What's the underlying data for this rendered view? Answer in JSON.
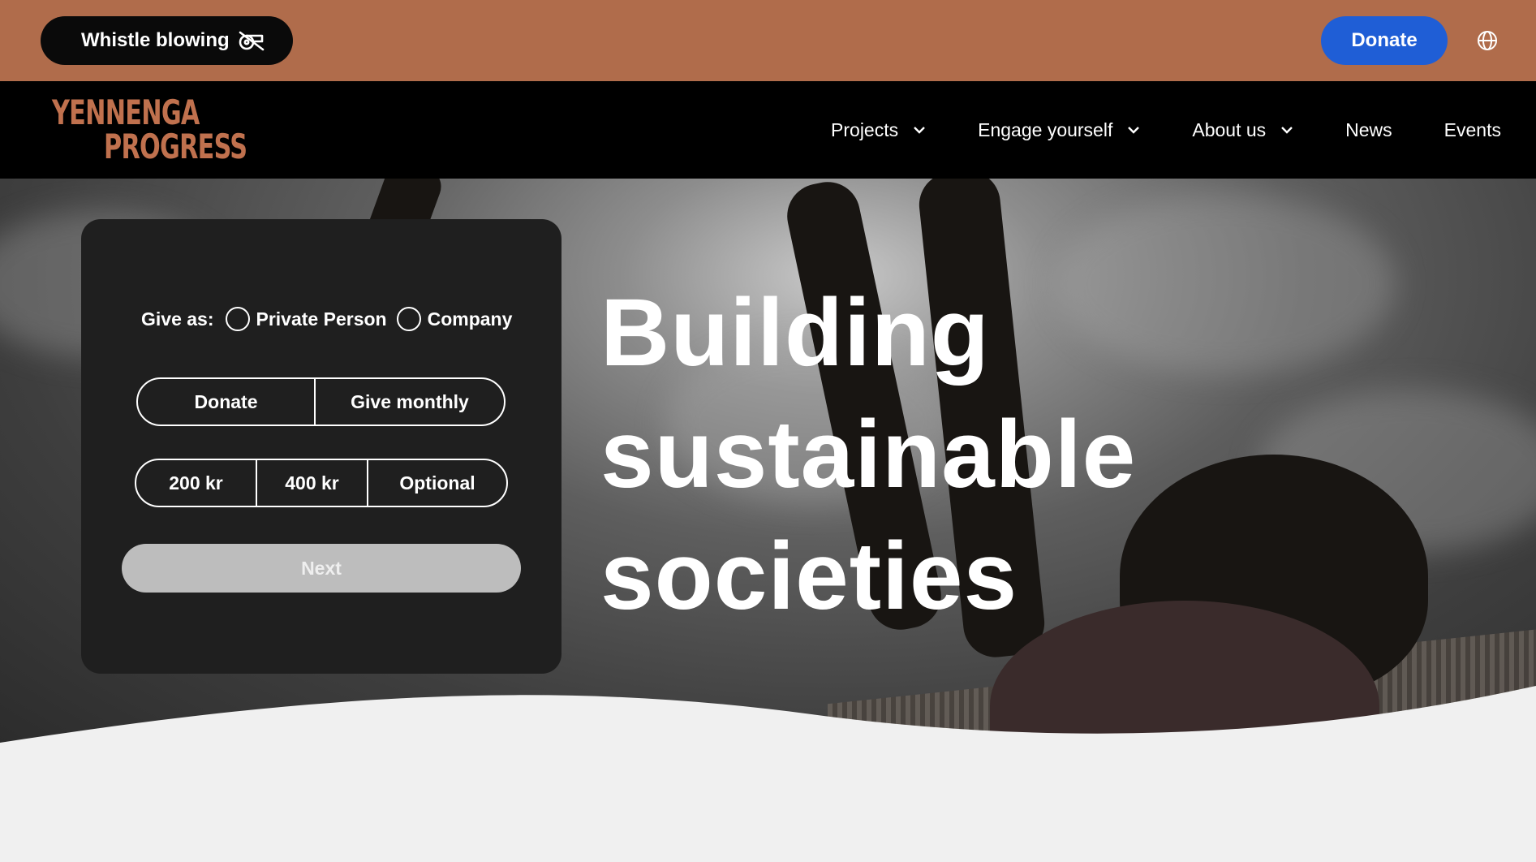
{
  "topbar": {
    "whistle_label": "Whistle blowing",
    "donate_label": "Donate",
    "whistle_icon": "whistle-icon",
    "language_icon": "globe-icon"
  },
  "nav": {
    "logo_line1": "YENNENGA",
    "logo_line2": "PROGRESS",
    "items": [
      {
        "label": "Projects",
        "dropdown": true
      },
      {
        "label": "Engage yourself",
        "dropdown": true
      },
      {
        "label": "About us",
        "dropdown": true
      },
      {
        "label": "News",
        "dropdown": false
      },
      {
        "label": "Events",
        "dropdown": false
      }
    ]
  },
  "donation_form": {
    "give_as_label": "Give as:",
    "give_as_options": [
      "Private Person",
      "Company"
    ],
    "frequency_options": [
      "Donate",
      "Give monthly"
    ],
    "amount_options": [
      "200 kr",
      "400 kr",
      "Optional"
    ],
    "next_label": "Next"
  },
  "hero": {
    "headline_lines": [
      "Building",
      "sustainable",
      "societies"
    ]
  },
  "colors": {
    "topbar": "#b06c4b",
    "accent_blue": "#1f5ed6",
    "logo": "#c0714e",
    "card": "#1f1f1f",
    "page_bg": "#f0f0f0"
  }
}
